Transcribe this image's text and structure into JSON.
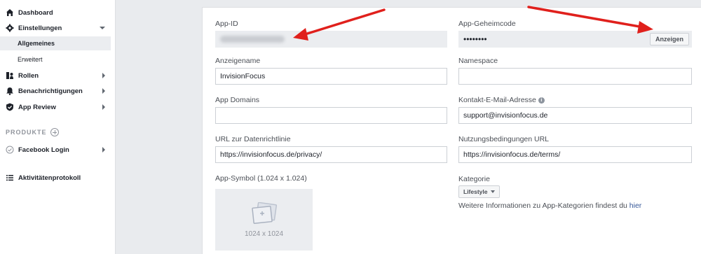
{
  "sidebar": {
    "dashboard": "Dashboard",
    "settings": "Einstellungen",
    "settings_general": "Allgemeines",
    "settings_advanced": "Erweitert",
    "roles": "Rollen",
    "notifications": "Benachrichtigungen",
    "app_review": "App Review",
    "products_title": "PRODUKTE",
    "facebook_login": "Facebook Login",
    "activity_log": "Aktivitätenprotokoll"
  },
  "form": {
    "app_id_label": "App-ID",
    "app_secret_label": "App-Geheimcode",
    "app_secret_value": "••••••••",
    "show_button": "Anzeigen",
    "display_name_label": "Anzeigename",
    "display_name_value": "InvisionFocus",
    "namespace_label": "Namespace",
    "namespace_value": "",
    "app_domains_label": "App Domains",
    "app_domains_value": "",
    "contact_email_label": "Kontakt-E-Mail-Adresse",
    "contact_email_value": "support@invisionfocus.de",
    "privacy_url_label": "URL zur Datenrichtlinie",
    "privacy_url_value": "https://invisionfocus.de/privacy/",
    "terms_url_label": "Nutzungsbedingungen URL",
    "terms_url_value": "https://invisionfocus.de/terms/",
    "app_icon_label": "App-Symbol (1.024 x 1.024)",
    "app_icon_size": "1024 x 1024",
    "category_label": "Kategorie",
    "category_value": "Lifestyle",
    "category_info": "Weitere Informationen zu App-Kategorien findest du",
    "category_info_link": "hier"
  },
  "colors": {
    "annotation_arrow": "#e0201c",
    "link": "#365899"
  }
}
